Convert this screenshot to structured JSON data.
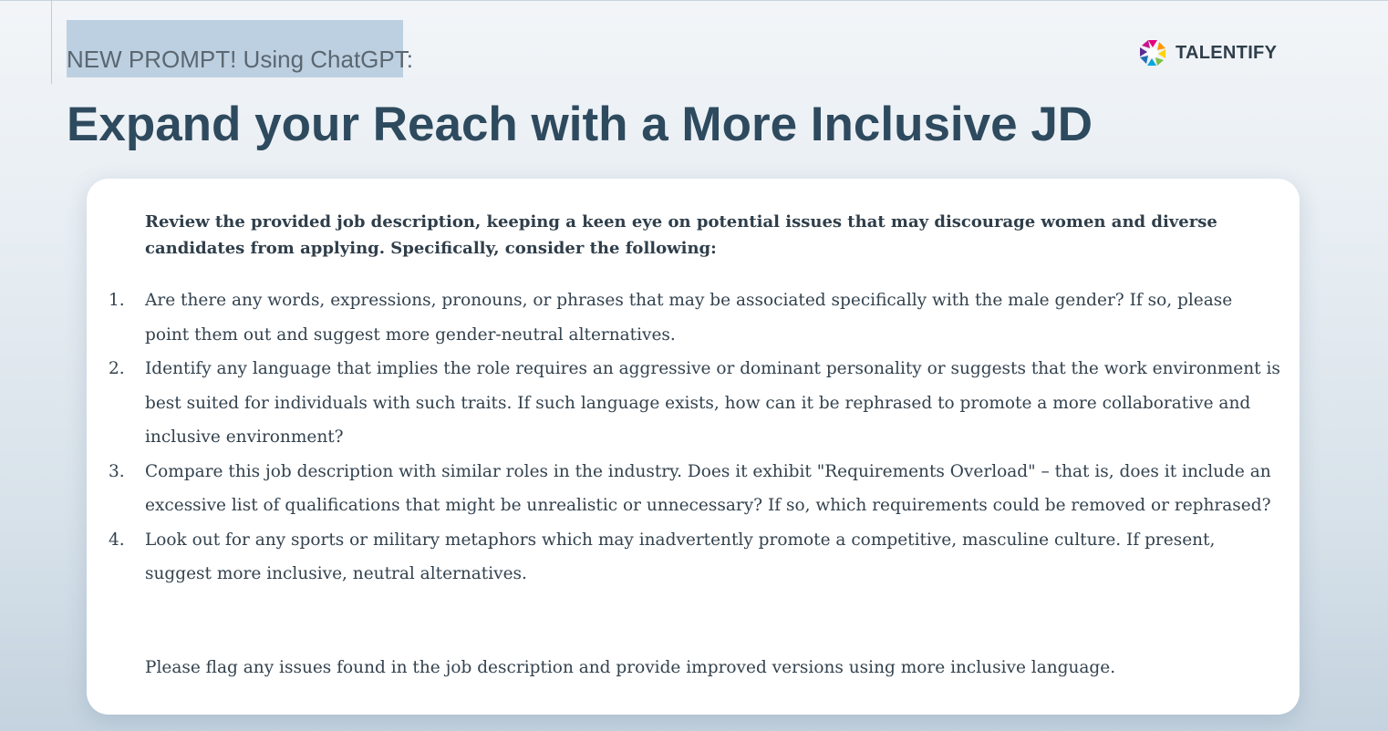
{
  "header": {
    "subtitle": "NEW PROMPT! Using ChatGPT:",
    "title": "Expand your Reach with a More Inclusive JD"
  },
  "brand": {
    "name": "TALENTIFY",
    "logo_icon": "talentify-logo-icon",
    "logo_colors": [
      "#e6007e",
      "#ff9900",
      "#ffd400",
      "#7ac143",
      "#00a7e1",
      "#5b2d90"
    ]
  },
  "card": {
    "intro": "Review the provided job description, keeping a keen eye on potential issues that may discourage women and diverse candidates from applying. Specifically, consider the following:",
    "items": [
      {
        "number": "1.",
        "text": "Are there any words, expressions, pronouns, or phrases that may be associated specifically with the male gender? If so, please point them out and suggest more gender-neutral alternatives."
      },
      {
        "number": "2.",
        "text": "Identify any language that implies the role requires an aggressive or dominant personality or suggests that the work environment is best suited for individuals with such traits. If such language exists, how can it be rephrased to promote a more collaborative and inclusive environment?"
      },
      {
        "number": "3.",
        "text": "Compare this job description with similar roles in the industry. Does it exhibit \"Requirements Overload\" – that is, does it include an excessive list of qualifications that might be unrealistic or unnecessary? If so, which requirements could be removed or rephrased?"
      },
      {
        "number": "4.",
        "text": "Look out for any sports or military metaphors which may inadvertently promote a competitive, masculine culture. If present, suggest more inclusive, neutral alternatives."
      }
    ],
    "closing": "Please flag any issues found in the job description and provide improved versions using more inclusive language."
  },
  "colors": {
    "title": "#2e4a5e",
    "subtitle_highlight": "#bdd0e1",
    "body_text": "#33424e"
  }
}
